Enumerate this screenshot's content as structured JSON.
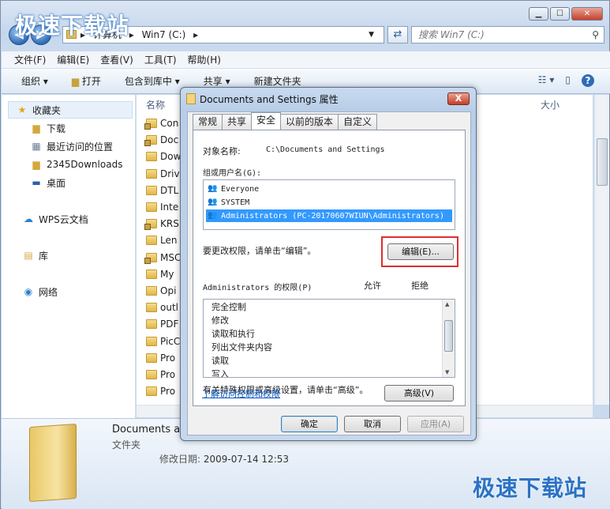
{
  "watermark": "极速下载站",
  "explorer": {
    "nav": {
      "back": "◀",
      "forward": "▶"
    },
    "address": {
      "crumbs": [
        "计算机",
        "Win7 (C:)"
      ],
      "sep": "▸"
    },
    "search_placeholder": "搜索 Win7 (C:)",
    "menu": [
      "文件(F)",
      "编辑(E)",
      "查看(V)",
      "工具(T)",
      "帮助(H)"
    ],
    "toolbar": {
      "organize": "组织 ▾",
      "open": "打开",
      "include": "包含到库中 ▾",
      "share": "共享 ▾",
      "new_folder": "新建文件夹"
    },
    "sidebar": {
      "favorites": "收藏夹",
      "items": [
        "下载",
        "最近访问的位置",
        "2345Downloads",
        "桌面"
      ],
      "wps": "WPS云文档",
      "library": "库",
      "network": "网络"
    },
    "columns": {
      "name": "名称",
      "size": "大小"
    },
    "files": [
      "Con",
      "Doc",
      "Dow",
      "Driv",
      "DTL",
      "Inte",
      "KRS",
      "Len",
      "MSC",
      "My",
      "Opi",
      "outl",
      "PDF",
      "PicC",
      "Pro",
      "Pro",
      "Pro"
    ],
    "details": {
      "name": "Documents ar",
      "type": "文件夹",
      "date_label": "修改日期:",
      "date": "2009-07-14 12:53"
    }
  },
  "dialog": {
    "title": "Documents and Settings 属性",
    "close": "X",
    "tabs": [
      "常规",
      "共享",
      "安全",
      "以前的版本",
      "自定义"
    ],
    "active_tab": "安全",
    "object_label": "对象名称:",
    "object_value": "C:\\Documents and Settings",
    "group_label": "组或用户名(G):",
    "users": [
      "Everyone",
      "SYSTEM",
      "Administrators (PC-20170607WIUN\\Administrators)"
    ],
    "selected_user": "Administrators (PC-20170607WIUN\\Administrators)",
    "change_hint": "要更改权限，请单击“编辑”。",
    "edit_button": "编辑(E)...",
    "perm_label": "Administrators 的权限(P)",
    "allow": "允许",
    "deny": "拒绝",
    "permissions": [
      "完全控制",
      "修改",
      "读取和执行",
      "列出文件夹内容",
      "读取",
      "写入"
    ],
    "advanced_hint": "有关特殊权限或高级设置，请单击“高级”。",
    "advanced_button": "高级(V)",
    "link": "了解访问控制和权限",
    "ok": "确定",
    "cancel": "取消",
    "apply": "应用(A)"
  }
}
